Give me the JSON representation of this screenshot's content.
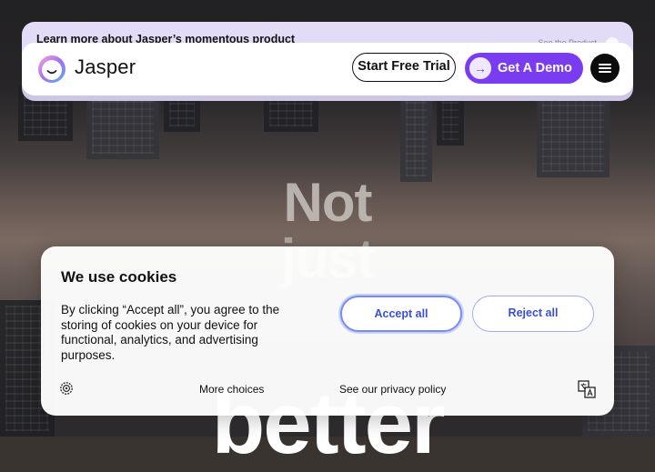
{
  "banner": {
    "text": "Learn more about Jasper’s momentous product",
    "link": "See the Product"
  },
  "nav": {
    "brand": "Jasper",
    "trial_label": "Start Free Trial",
    "demo_label": "Get A Demo",
    "demo_arrow": "→",
    "menu_icon": "hamburger-icon"
  },
  "hero": {
    "line1": "Not",
    "line2": "just",
    "line3": "better"
  },
  "cookies": {
    "title": "We use cookies",
    "body": "By clicking “Accept all”, you agree to the storing of cookies on your device for functional, analytics, and advertising purposes.",
    "accept_label": "Accept all",
    "reject_label": "Reject all",
    "more_label": "More choices",
    "privacy_label": "See our privacy policy",
    "settings_icon": "gear-icon",
    "language_icon": "translate-icon"
  },
  "colors": {
    "brand_purple": "#7a3cf0",
    "banner_bg": "#e3dcf7",
    "cookie_button_text": "#3b4fd6"
  }
}
